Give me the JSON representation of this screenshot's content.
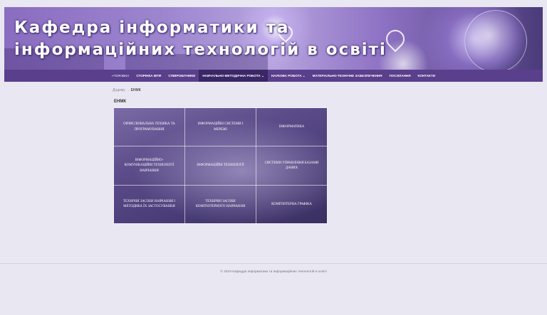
{
  "header": {
    "title_line1": "Кафедра інформатики та",
    "title_line2": "інформаційних технологій в освіті"
  },
  "nav": {
    "items": [
      {
        "label": "Головна"
      },
      {
        "label": "Сторінка ВПФ"
      },
      {
        "label": "Співробітники"
      },
      {
        "label": "Навчально-методична робота ⌄"
      },
      {
        "label": "Наукова робота ⌄"
      },
      {
        "label": "Матеріально-технічне забезпечення"
      },
      {
        "label": "Посилання"
      },
      {
        "label": "Контакти"
      }
    ]
  },
  "breadcrumb": {
    "home": "Додому",
    "sep": "→",
    "current": "ЕНМК"
  },
  "page": {
    "title": "ЕНМК"
  },
  "tiles": [
    "Обчислювальна техніка та програмування",
    "Інформаційні системи і мережі",
    "Інформатика",
    "Інформаційно-комунікаційні технології навчання",
    "Інформаційні технології",
    "Системи управління базами даних",
    "Технічні засоби навчання і методика їх застосування",
    "Технічні засоби комп'ютерного навчання",
    "Комп'ютерна графіка"
  ],
  "footer": {
    "text": "© 2019 Кафедра інформатики та інформаційних технологій в освіті"
  }
}
